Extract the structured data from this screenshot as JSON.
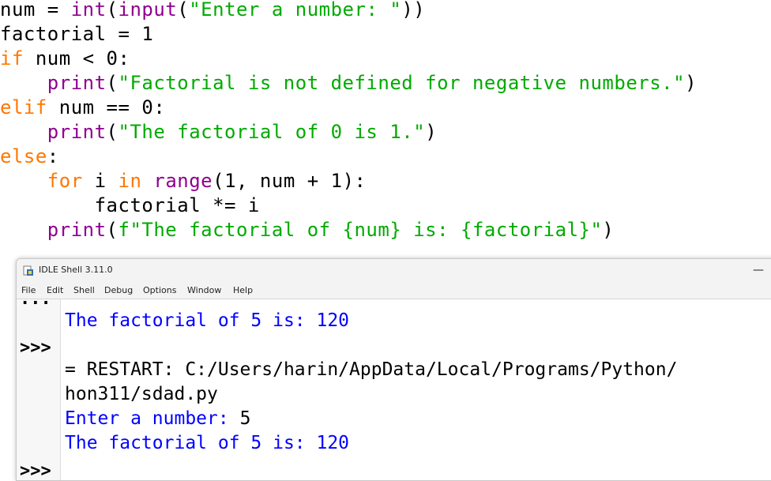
{
  "editor": {
    "line1": {
      "var": "num = ",
      "int": "int",
      "p1": "(",
      "input": "input",
      "p2": "(",
      "str": "\"Enter a number: \"",
      "p3": "))"
    },
    "line2": "factorial = 1",
    "line3": {
      "kw": "if",
      "rest": " num < 0:"
    },
    "line4": {
      "indent": "    ",
      "fn": "print",
      "p1": "(",
      "str": "\"Factorial is not defined for negative numbers.\"",
      "p2": ")"
    },
    "line5": {
      "kw": "elif",
      "rest": " num == 0:"
    },
    "line6": {
      "indent": "    ",
      "fn": "print",
      "p1": "(",
      "str": "\"The factorial of 0 is 1.\"",
      "p2": ")"
    },
    "line7": {
      "kw": "else",
      "rest": ":"
    },
    "line8": {
      "indent": "    ",
      "kw1": "for",
      "mid1": " i ",
      "kw2": "in",
      "mid2": " ",
      "fn": "range",
      "rest": "(1, num + 1):"
    },
    "line9": "        factorial *= i",
    "line10": {
      "indent": "    ",
      "fn": "print",
      "p1": "(",
      "str": "f\"The factorial of {num} is: {factorial}\"",
      "p2": ")"
    }
  },
  "shell": {
    "title": "IDLE Shell 3.11.0",
    "minimize": "—",
    "menu": [
      "File",
      "Edit",
      "Shell",
      "Debug",
      "Options",
      "Window",
      "Help"
    ],
    "prompts": [
      "...",
      ">>>",
      ">>>"
    ],
    "lines": [
      "The factorial of 5 is: 120",
      "= RESTART: C:/Users/harin/AppData/Local/Programs/Python/",
      "hon311/sdad.py",
      "Enter a number: ",
      "5",
      "The factorial of 5 is: 120"
    ]
  },
  "colors": {
    "keyword": "#ff7700",
    "builtin": "#900090",
    "string": "#00aa00",
    "output": "#0000ff"
  }
}
